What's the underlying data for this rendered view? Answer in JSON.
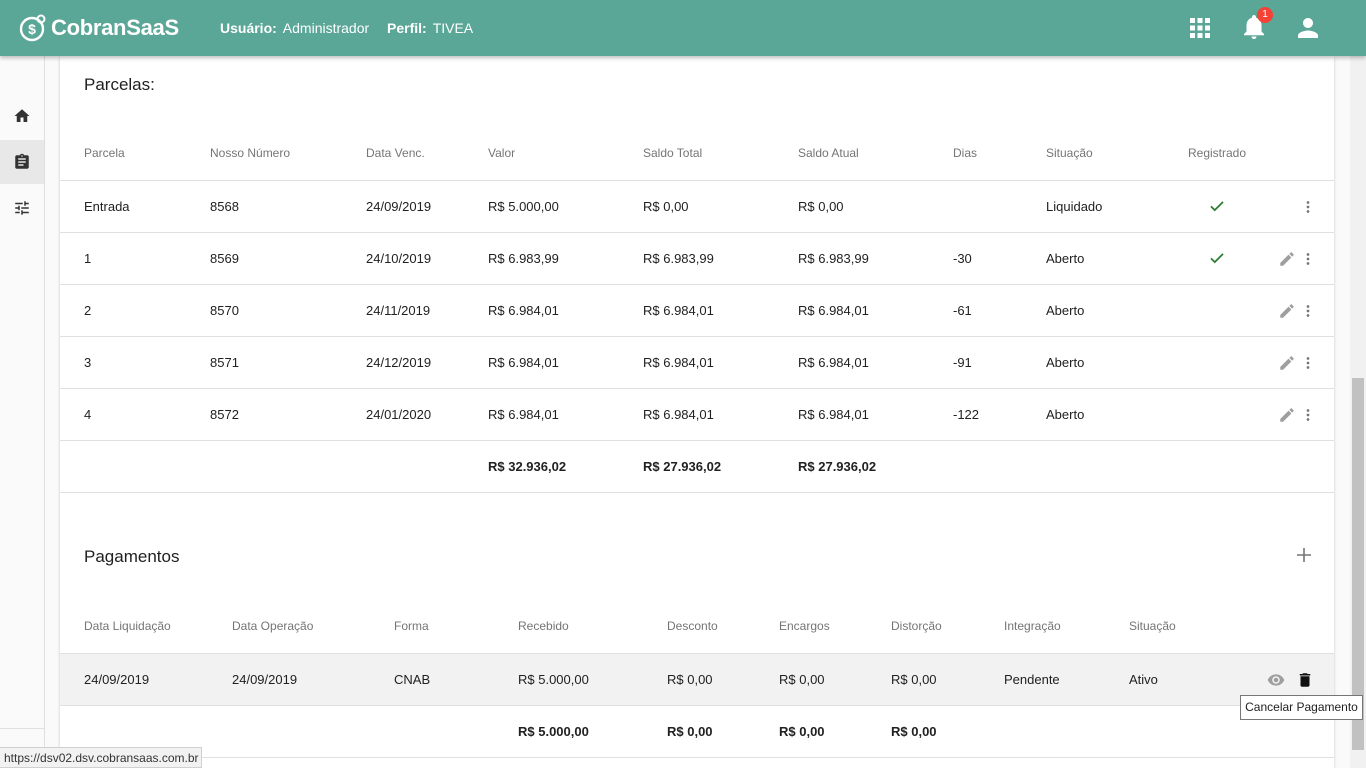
{
  "topbar": {
    "app_name": "CobranSaaS",
    "user_label": "Usuário:",
    "user_value": "Administrador",
    "profile_label": "Perfil:",
    "profile_value": "TIVEA",
    "notifications_count": "1",
    "icons": [
      "apps-grid-icon",
      "bell-icon",
      "account-icon"
    ]
  },
  "sidebar": {
    "items": [
      {
        "icon": "home-icon",
        "active": false
      },
      {
        "icon": "clipboard-icon",
        "active": true
      },
      {
        "icon": "tune-sliders-icon",
        "active": false
      }
    ]
  },
  "parcelas": {
    "title": "Parcelas:",
    "headers": [
      "Parcela",
      "Nosso Número",
      "Data Venc.",
      "Valor",
      "Saldo Total",
      "Saldo Atual",
      "Dias",
      "Situação",
      "Registrado"
    ],
    "rows": [
      {
        "parcela": "Entrada",
        "nosso_numero": "8568",
        "data_venc": "24/09/2019",
        "valor": "R$ 5.000,00",
        "saldo_total": "R$ 0,00",
        "saldo_atual": "R$ 0,00",
        "dias": "",
        "situacao": "Liquidado",
        "registrado": true,
        "editable": false
      },
      {
        "parcela": "1",
        "nosso_numero": "8569",
        "data_venc": "24/10/2019",
        "valor": "R$ 6.983,99",
        "saldo_total": "R$ 6.983,99",
        "saldo_atual": "R$ 6.983,99",
        "dias": "-30",
        "situacao": "Aberto",
        "registrado": true,
        "editable": true
      },
      {
        "parcela": "2",
        "nosso_numero": "8570",
        "data_venc": "24/11/2019",
        "valor": "R$ 6.984,01",
        "saldo_total": "R$ 6.984,01",
        "saldo_atual": "R$ 6.984,01",
        "dias": "-61",
        "situacao": "Aberto",
        "registrado": false,
        "editable": true
      },
      {
        "parcela": "3",
        "nosso_numero": "8571",
        "data_venc": "24/12/2019",
        "valor": "R$ 6.984,01",
        "saldo_total": "R$ 6.984,01",
        "saldo_atual": "R$ 6.984,01",
        "dias": "-91",
        "situacao": "Aberto",
        "registrado": false,
        "editable": true
      },
      {
        "parcela": "4",
        "nosso_numero": "8572",
        "data_venc": "24/01/2020",
        "valor": "R$ 6.984,01",
        "saldo_total": "R$ 6.984,01",
        "saldo_atual": "R$ 6.984,01",
        "dias": "-122",
        "situacao": "Aberto",
        "registrado": false,
        "editable": true
      }
    ],
    "totals": {
      "valor": "R$ 32.936,02",
      "saldo_total": "R$ 27.936,02",
      "saldo_atual": "R$ 27.936,02"
    }
  },
  "pagamentos": {
    "title": "Pagamentos",
    "headers": [
      "Data Liquidação",
      "Data Operação",
      "Forma",
      "Recebido",
      "Desconto",
      "Encargos",
      "Distorção",
      "Integração",
      "Situação"
    ],
    "rows": [
      {
        "data_liquidacao": "24/09/2019",
        "data_operacao": "24/09/2019",
        "forma": "CNAB",
        "recebido": "R$ 5.000,00",
        "desconto": "R$ 0,00",
        "encargos": "R$ 0,00",
        "distorcao": "R$ 0,00",
        "integracao": "Pendente",
        "situacao": "Ativo"
      }
    ],
    "totals": {
      "recebido": "R$ 5.000,00",
      "desconto": "R$ 0,00",
      "encargos": "R$ 0,00",
      "distorcao": "R$ 0,00"
    }
  },
  "tooltip": "Cancelar Pagamento",
  "status_url": "https://dsv02.dsv.cobransaas.com.br",
  "colors": {
    "primary": "#5aa697",
    "check": "#2e7d32",
    "badge": "#f44336"
  }
}
